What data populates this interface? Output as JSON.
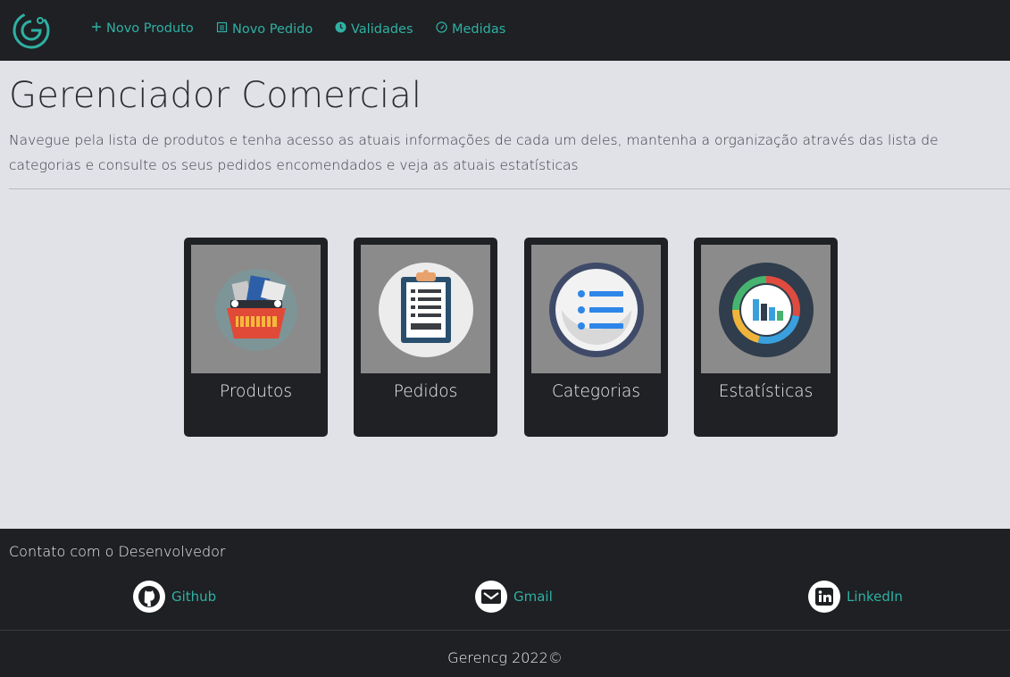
{
  "nav": {
    "items": [
      {
        "label": "Novo Produto",
        "icon": "plus-icon"
      },
      {
        "label": "Novo Pedido",
        "icon": "clipboard-icon"
      },
      {
        "label": "Validades",
        "icon": "clock-icon"
      },
      {
        "label": "Medidas",
        "icon": "gauge-icon"
      }
    ],
    "accent": "#2fb0a4"
  },
  "header": {
    "title": "Gerenciador Comercial",
    "lead": "Navegue pela lista de produtos e tenha acesso as atuais informações de cada um deles, mantenha a organização através das lista de categorias e consulte os seus pedidos encomendados e veja as atuais estatísticas"
  },
  "cards": [
    {
      "label": "Produtos",
      "icon": "shopping-basket-icon"
    },
    {
      "label": "Pedidos",
      "icon": "clipboard-list-icon"
    },
    {
      "label": "Categorias",
      "icon": "list-icon"
    },
    {
      "label": "Estatísticas",
      "icon": "bar-chart-icon"
    }
  ],
  "footer": {
    "contact_title": "Contato com o Desenvolvedor",
    "links": [
      {
        "label": "Github",
        "icon": "github-icon"
      },
      {
        "label": "Gmail",
        "icon": "gmail-icon"
      },
      {
        "label": "LinkedIn",
        "icon": "linkedin-icon"
      }
    ],
    "copyright": "Gerencg 2022©"
  }
}
